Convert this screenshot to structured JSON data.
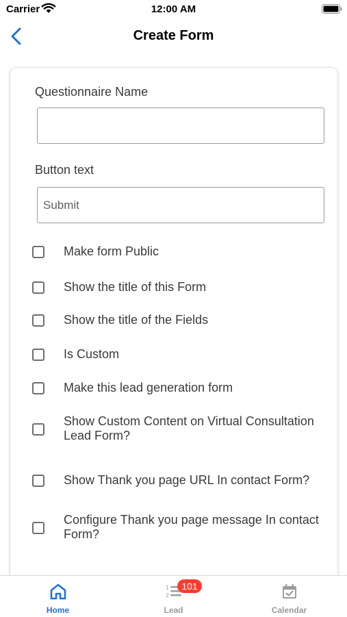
{
  "status_bar": {
    "carrier": "Carrier",
    "time": "12:00 AM"
  },
  "nav": {
    "title": "Create Form"
  },
  "form": {
    "name_label": "Questionnaire Name",
    "name_value": "",
    "button_text_label": "Button text",
    "button_text_placeholder": "Submit",
    "checkboxes": [
      {
        "label": "Make form Public",
        "checked": false
      },
      {
        "label": "Show the title of this Form",
        "checked": false
      },
      {
        "label": "Show the title of the Fields",
        "checked": false
      },
      {
        "label": "Is Custom",
        "checked": false
      },
      {
        "label": "Make this lead generation form",
        "checked": false
      },
      {
        "label": "Show Custom Content on Virtual Consultation Lead Form?",
        "checked": false
      },
      {
        "label": "Show Thank you page URL In contact Form?",
        "checked": false
      },
      {
        "label": "Configure Thank you page message In contact Form?",
        "checked": false
      }
    ]
  },
  "tabs": [
    {
      "label": "Home",
      "active": true,
      "icon": "home-icon"
    },
    {
      "label": "Lead",
      "active": false,
      "icon": "list-numbered-icon",
      "badge": "101"
    },
    {
      "label": "Calendar",
      "active": false,
      "icon": "calendar-check-icon"
    }
  ],
  "colors": {
    "accent": "#1f6fe0",
    "inactive": "#9a9a9f",
    "badge": "#ff3b30"
  }
}
